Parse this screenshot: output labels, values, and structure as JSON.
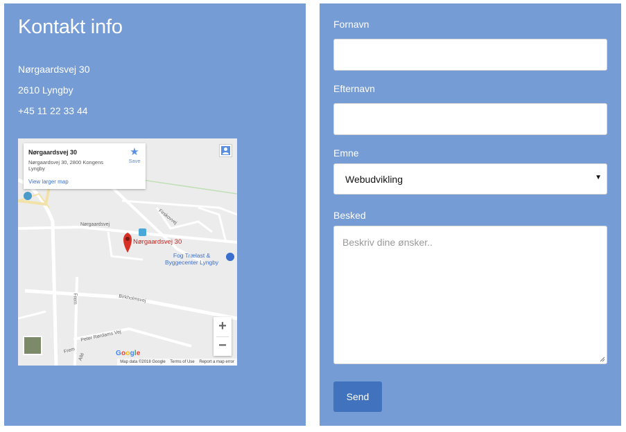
{
  "contact": {
    "title": "Kontakt info",
    "street": "Nørgaardsvej 30",
    "city": "2610 Lyngby",
    "phone": "+45 11 22 33 44"
  },
  "map": {
    "card_title": "Nørgaardsvej 30",
    "card_address": "Nørgaardsvej 30, 2800 Kongens Lyngby",
    "card_link": "View larger map",
    "save_label": "Save",
    "pin_label": "Nørgaardsvej 30",
    "poi_label_line1": "Fog Trælast &",
    "poi_label_line2": "Byggecenter Lyngby",
    "street_labels": [
      "Nørgaardsvej",
      "Firskovvej",
      "Birkholmsvej",
      "Frem",
      "Peter Rørdams Vej",
      "Allé",
      "Frem"
    ],
    "zoom_in": "+",
    "zoom_out": "−",
    "google_logo": "Google",
    "footer_data": "Map data ©2018 Google",
    "footer_terms": "Terms of Use",
    "footer_report": "Report a map error"
  },
  "form": {
    "first_name_label": "Fornavn",
    "first_name_value": "",
    "last_name_label": "Efternavn",
    "last_name_value": "",
    "subject_label": "Emne",
    "subject_value": "Webudvikling",
    "message_label": "Besked",
    "message_placeholder": "Beskriv dine ønsker..",
    "send_label": "Send"
  },
  "colors": {
    "panel": "#759cd4",
    "button": "#4172bd",
    "pin": "#c5221f"
  }
}
